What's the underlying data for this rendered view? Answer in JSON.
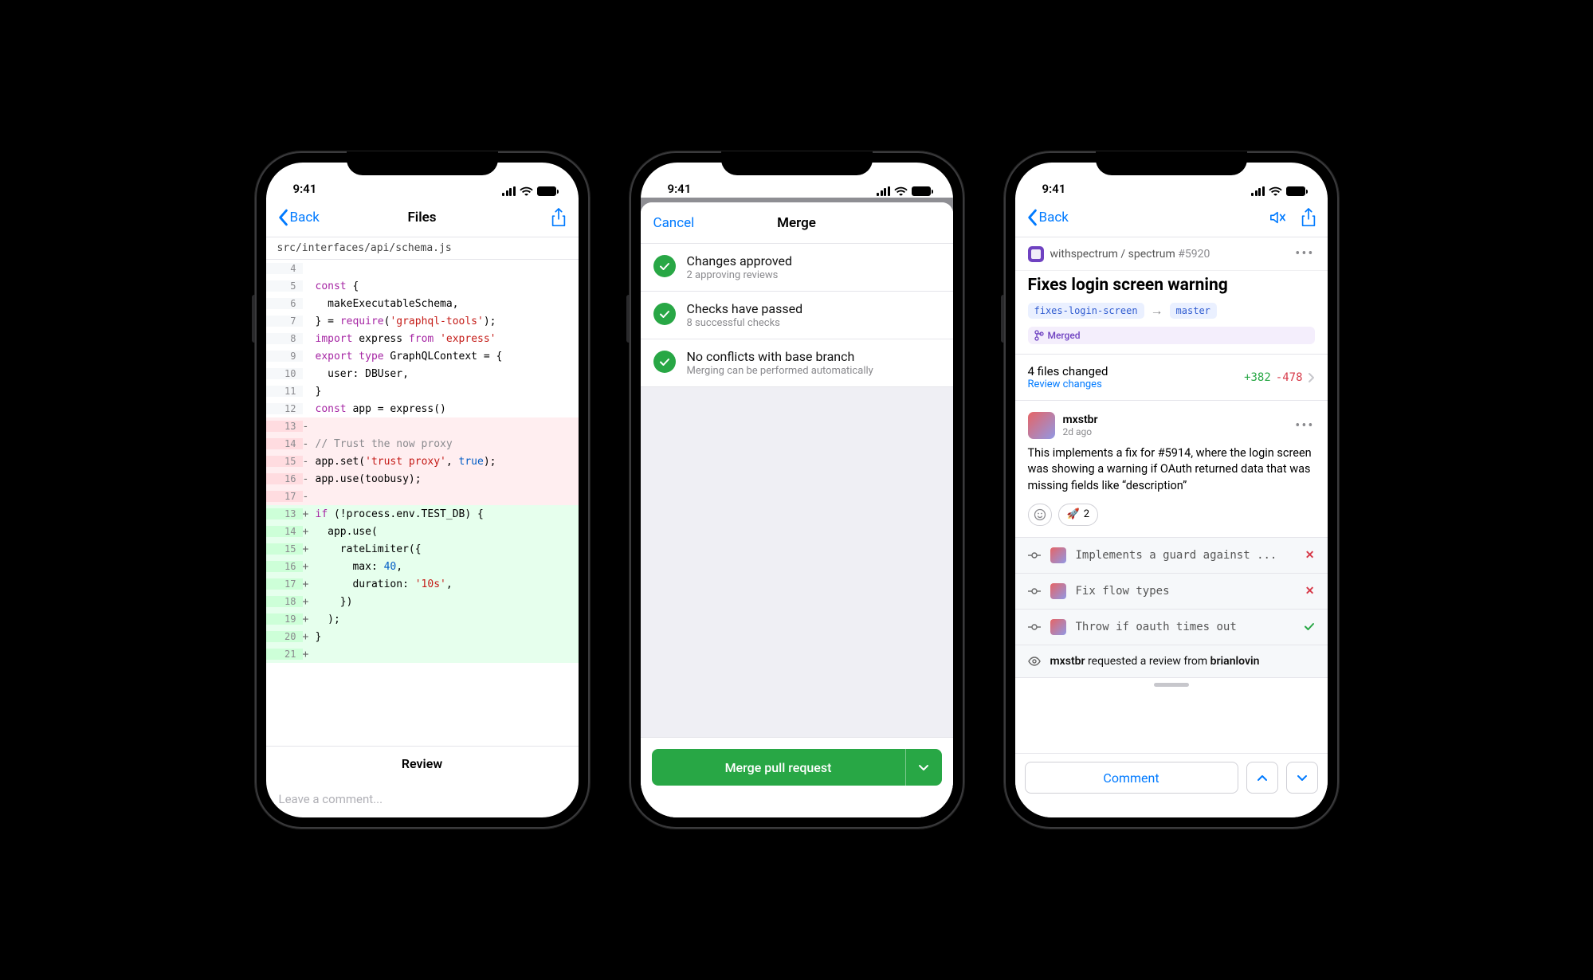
{
  "status": {
    "time": "9:41"
  },
  "p1": {
    "nav": {
      "back": "Back",
      "title": "Files"
    },
    "filepath": "src/interfaces/api/schema.js",
    "lines": [
      {
        "kind": "ctx",
        "ln": "4",
        "m": " ",
        "code": ""
      },
      {
        "kind": "ctx",
        "ln": "5",
        "m": " ",
        "code": "const {",
        "cls": "kw0"
      },
      {
        "kind": "ctx",
        "ln": "6",
        "m": " ",
        "code": "  makeExecutableSchema,"
      },
      {
        "kind": "ctx",
        "ln": "7",
        "m": " ",
        "code": "} = require('graphql-tools');",
        "cls": "req"
      },
      {
        "kind": "ctx",
        "ln": "8",
        "m": " ",
        "code": "import express from 'express'",
        "cls": "imp"
      },
      {
        "kind": "ctx",
        "ln": "9",
        "m": " ",
        "code": "export type GraphQLContext = {",
        "cls": "exp"
      },
      {
        "kind": "ctx",
        "ln": "10",
        "m": " ",
        "code": "  user: DBUser,"
      },
      {
        "kind": "ctx",
        "ln": "11",
        "m": " ",
        "code": "}"
      },
      {
        "kind": "ctx",
        "ln": "12",
        "m": " ",
        "code": "const app = express()",
        "cls": "kw0"
      },
      {
        "kind": "del",
        "ln": "13",
        "m": "-",
        "code": ""
      },
      {
        "kind": "del",
        "ln": "14",
        "m": "-",
        "code": "// Trust the now proxy",
        "cls": "cm"
      },
      {
        "kind": "del",
        "ln": "15",
        "m": "-",
        "code": "app.set('trust proxy', true);",
        "cls": "set"
      },
      {
        "kind": "del",
        "ln": "16",
        "m": "-",
        "code": "app.use(toobusy);"
      },
      {
        "kind": "del",
        "ln": "17",
        "m": "-",
        "code": ""
      },
      {
        "kind": "add",
        "ln": "13",
        "m": "+",
        "code": "if (!process.env.TEST_DB) {",
        "cls": "if"
      },
      {
        "kind": "add",
        "ln": "14",
        "m": "+",
        "code": "  app.use("
      },
      {
        "kind": "add",
        "ln": "15",
        "m": "+",
        "code": "    rateLimiter({"
      },
      {
        "kind": "add",
        "ln": "16",
        "m": "+",
        "code": "      max: 40,",
        "cls": "num"
      },
      {
        "kind": "add",
        "ln": "17",
        "m": "+",
        "code": "      duration: '10s',",
        "cls": "str"
      },
      {
        "kind": "add",
        "ln": "18",
        "m": "+",
        "code": "    })"
      },
      {
        "kind": "add",
        "ln": "19",
        "m": "+",
        "code": "  );"
      },
      {
        "kind": "add",
        "ln": "20",
        "m": "+",
        "code": "}"
      },
      {
        "kind": "add",
        "ln": "21",
        "m": "+",
        "code": ""
      }
    ],
    "review_label": "Review",
    "comment_placeholder": "Leave a comment..."
  },
  "p2": {
    "cancel": "Cancel",
    "title": "Merge",
    "checks": [
      {
        "title": "Changes approved",
        "sub": "2 approving reviews"
      },
      {
        "title": "Checks have passed",
        "sub": "8 successful checks"
      },
      {
        "title": "No conflicts with base branch",
        "sub": "Merging can be performed automatically"
      }
    ],
    "merge_btn": "Merge pull request"
  },
  "p3": {
    "nav": {
      "back": "Back"
    },
    "repo": {
      "owner": "withspectrum",
      "name": "spectrum",
      "number": "#5920"
    },
    "title": "Fixes login screen warning",
    "branch_from": "fixes-login-screen",
    "branch_to": "master",
    "status": "Merged",
    "files": {
      "label": "4 files changed",
      "review": "Review changes",
      "plus": "+382",
      "minus": "-478"
    },
    "author": {
      "name": "mxstbr",
      "time": "2d ago"
    },
    "body": "This implements a fix for #5914, where the login screen was showing a warning if OAuth returned data that was missing fields like “description”",
    "reaction_count": "2",
    "commits": [
      {
        "msg": "Implements a guard against ...",
        "status": "x"
      },
      {
        "msg": "Fix flow types",
        "status": "x"
      },
      {
        "msg": "Throw if oauth times out",
        "status": "v"
      }
    ],
    "event": {
      "actor": "mxstbr",
      "verb": "requested a review from",
      "target": "brianlovin"
    },
    "comment_btn": "Comment"
  }
}
